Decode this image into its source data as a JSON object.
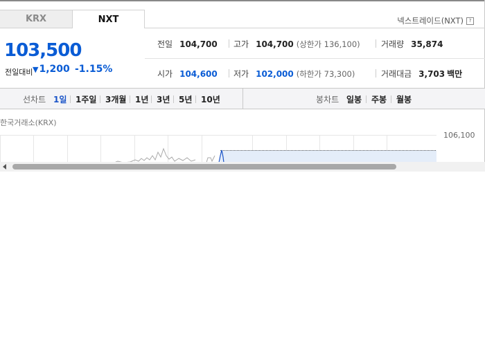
{
  "tabs": {
    "krx": "KRX",
    "nxt": "NXT"
  },
  "nxt_link": "넥스트레이드(NXT)",
  "price": {
    "current": "103,500",
    "change_label": "전일대비",
    "change": "1,200",
    "change_pct": "-1.15%",
    "direction": "down"
  },
  "stats": {
    "prev_close": {
      "label": "전일",
      "value": "104,700"
    },
    "high": {
      "label": "고가",
      "value": "104,700",
      "extra": "(상한가 136,100)"
    },
    "volume": {
      "label": "거래량",
      "value": "35,874"
    },
    "open": {
      "label": "시가",
      "value": "104,600"
    },
    "low": {
      "label": "저가",
      "value": "102,000",
      "extra": "(하한가 73,300)"
    },
    "amount": {
      "label": "거래대금",
      "value": "3,703",
      "unit": "백만"
    }
  },
  "chart_toolbar": {
    "line_label": "선차트",
    "periods": [
      "1일",
      "1주일",
      "3개월",
      "1년",
      "3년",
      "5년",
      "10년"
    ],
    "active_period": "1일",
    "candle_label": "봉차트",
    "candles": [
      "일봉",
      "주봉",
      "월봉"
    ]
  },
  "chart": {
    "exchange": "한국거래소(KRX)",
    "y_tick": "106,100"
  },
  "colors": {
    "accent": "#0a5cd5",
    "active": "#1a54c8"
  }
}
